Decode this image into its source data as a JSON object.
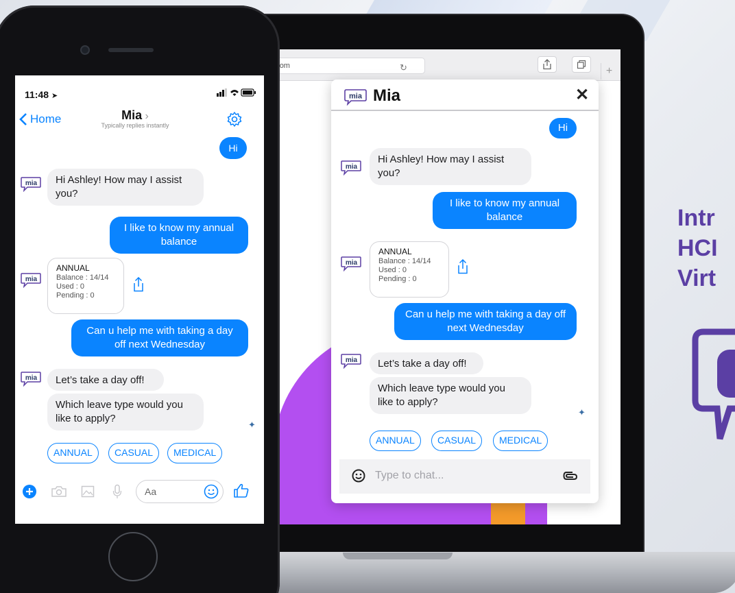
{
  "browser": {
    "url": "agehcm.com"
  },
  "desktop_chat": {
    "title": "Mia",
    "close_label": "✕",
    "logo_text": "mia",
    "messages": {
      "user_hi": "Hi",
      "bot_greeting": "Hi Ashley! How may I assist you?",
      "user_balance": "I like to know my annual balance",
      "user_dayoff": "Can u help me with taking a day off next Wednesday",
      "bot_dayoff": "Let’s take a day off!",
      "bot_question": "Which leave type would you like to apply?"
    },
    "card": {
      "title": "ANNUAL",
      "balance": "Balance : 14/14",
      "used": "Used : 0",
      "pending": "Pending : 0"
    },
    "chips": [
      "ANNUAL",
      "CASUAL",
      "MEDICAL"
    ],
    "input_placeholder": "Type to chat..."
  },
  "phone": {
    "status_time": "11:48",
    "nav_back": "Home",
    "chat_name": "Mia",
    "chat_subtitle": "Typically replies instantly",
    "compose_placeholder": "Aa",
    "logo_text": "mia",
    "messages": {
      "user_hi": "Hi",
      "bot_greeting": "Hi Ashley! How may I assist you?",
      "user_balance": "I like to know my annual balance",
      "user_dayoff": "Can u help me with taking a day off next Wednesday",
      "bot_dayoff": "Let’s take a day off!",
      "bot_question": "Which leave type would you like to apply?"
    },
    "card": {
      "title": "ANNUAL",
      "balance": "Balance : 14/14",
      "used": "Used : 0",
      "pending": "Pending : 0"
    },
    "chips": [
      "ANNUAL",
      "CASUAL",
      "MEDICAL"
    ]
  },
  "promo": {
    "line1": "Intr",
    "line2": "HCI",
    "line3": "Virt"
  },
  "colors": {
    "accent": "#0a84ff",
    "brand_purple": "#5b3fa4",
    "page_purple": "#b34ff0",
    "page_orange": "#f39a2a"
  }
}
